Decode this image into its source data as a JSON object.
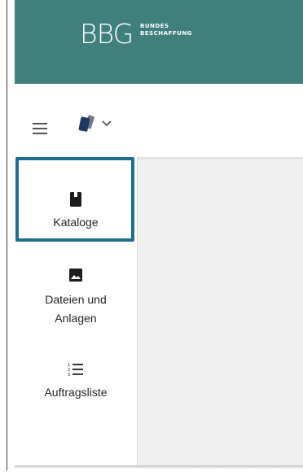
{
  "header": {
    "logo_text": "BBG",
    "logo_sub_line1": "BUNDES",
    "logo_sub_line2": "BESCHAFFUNG",
    "color": "#3f7f7c"
  },
  "toolbar": {
    "menu_icon": "hamburger-menu-icon",
    "switcher_icon": "cards-icon",
    "chevron_icon": "chevron-down-icon"
  },
  "sidebar": {
    "selected_color": "#1b6e92",
    "items": [
      {
        "label": "Kataloge",
        "icon": "book-icon",
        "selected": true
      },
      {
        "label_line1": "Dateien und",
        "label_line2": "Anlagen",
        "icon": "image-icon",
        "selected": false
      },
      {
        "label": "Auftragsliste",
        "icon": "numbered-list-icon",
        "selected": false
      }
    ]
  }
}
